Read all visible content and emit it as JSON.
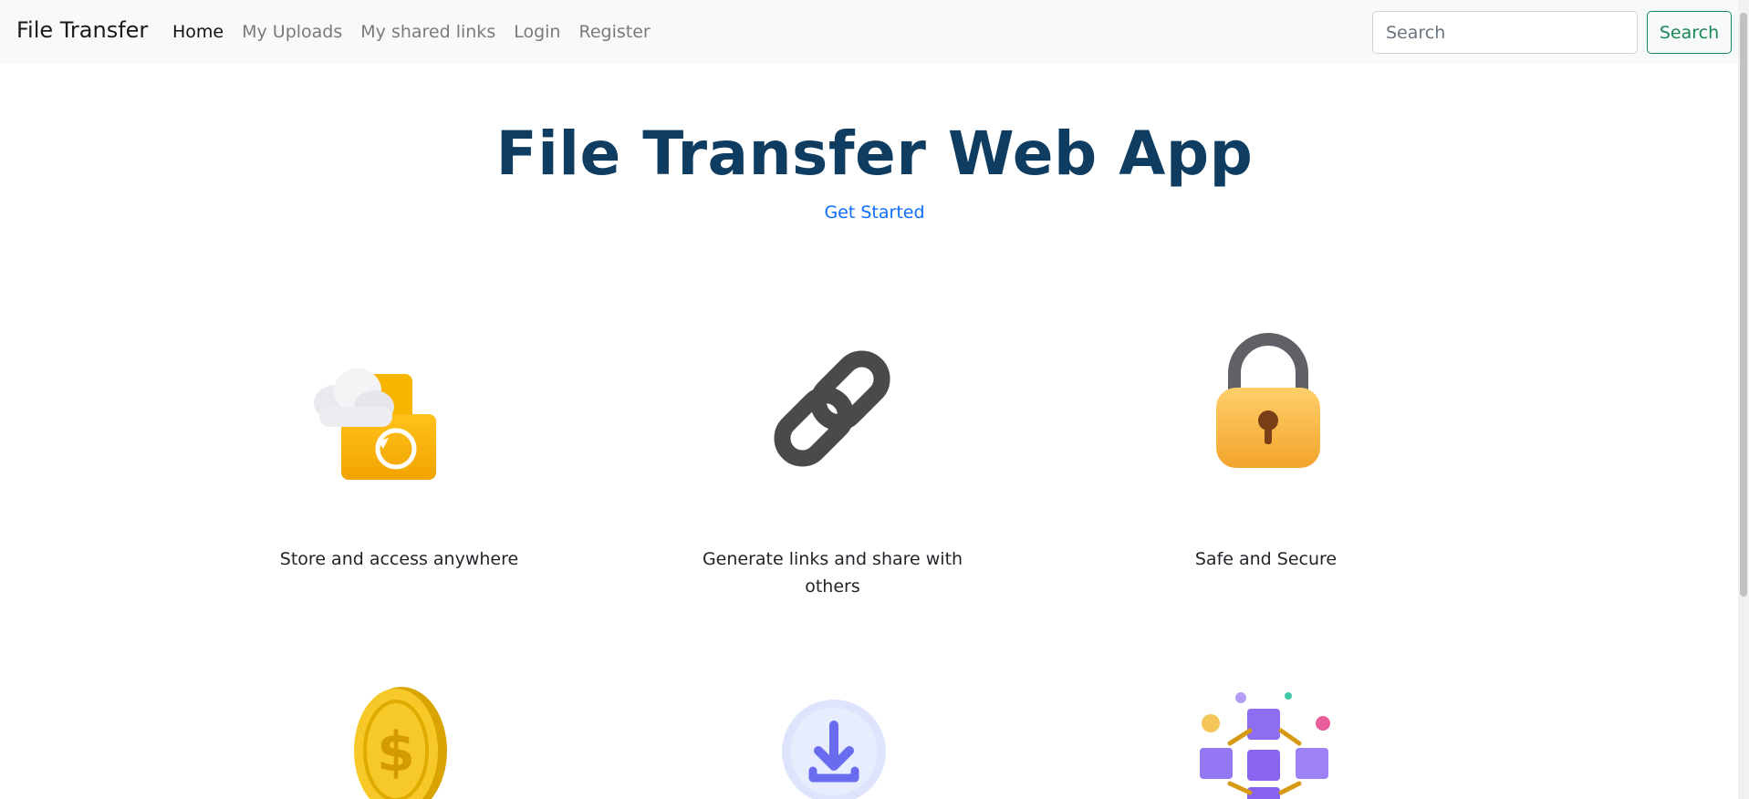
{
  "navbar": {
    "brand": "File Transfer",
    "links": [
      "Home",
      "My Uploads",
      "My shared links",
      "Login",
      "Register"
    ],
    "search_placeholder": "Search",
    "search_button": "Search"
  },
  "hero": {
    "title": "File Transfer Web App",
    "cta": "Get Started"
  },
  "features": [
    {
      "label": "Store and access anywhere",
      "icon": "cloud-folder-icon"
    },
    {
      "label": "Generate links and share with others",
      "icon": "link-icon"
    },
    {
      "label": "Safe and Secure",
      "icon": "padlock-icon"
    },
    {
      "label": "",
      "icon": "coin-icon"
    },
    {
      "label": "",
      "icon": "download-icon"
    },
    {
      "label": "",
      "icon": "blockchain-cubes-icon"
    }
  ],
  "colors": {
    "title": "#0f3d61",
    "link": "#0d6efd",
    "search_button": "#198754",
    "navbar_bg": "#f8f9fa"
  }
}
